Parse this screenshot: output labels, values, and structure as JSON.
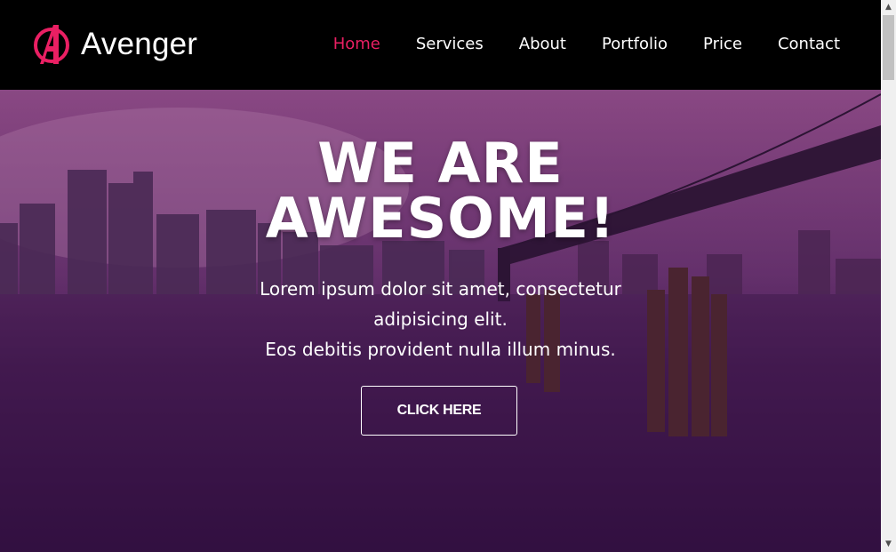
{
  "brand": {
    "name": "Avenger",
    "logo_icon": "avengers-a-logo-icon",
    "accent_color": "#ea1f63"
  },
  "nav": {
    "items": [
      {
        "label": "Home",
        "active": true
      },
      {
        "label": "Services",
        "active": false
      },
      {
        "label": "About",
        "active": false
      },
      {
        "label": "Portfolio",
        "active": false
      },
      {
        "label": "Price",
        "active": false
      },
      {
        "label": "Contact",
        "active": false
      }
    ]
  },
  "hero": {
    "title_line1": "WE ARE",
    "title_line2": "AWESOME!",
    "text_line1": "Lorem ipsum dolor sit amet, consectetur",
    "text_line2": "adipisicing elit.",
    "text_line3": "Eos debitis provident nulla illum minus.",
    "cta_label": "CLICK HERE",
    "background": "night-city-bridge-photo"
  },
  "scrollbar": {
    "up_icon": "scroll-up-arrow-icon",
    "down_icon": "scroll-down-arrow-icon"
  }
}
